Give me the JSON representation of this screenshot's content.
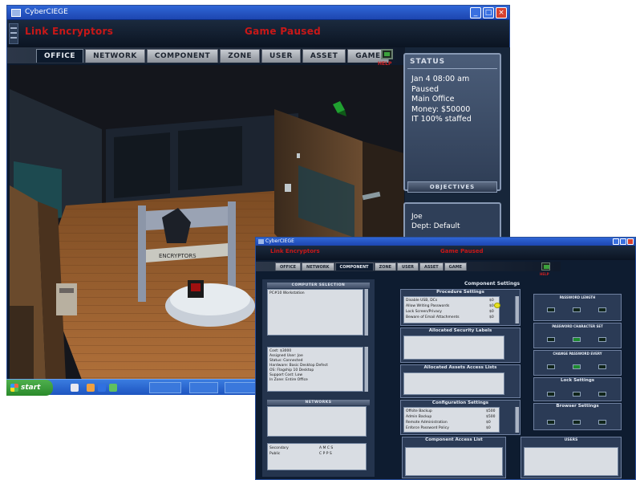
{
  "window1": {
    "title": "CyberCIEGE",
    "header_left": "Link Encryptors",
    "header_center": "Game Paused",
    "tabs": [
      "OFFICE",
      "NETWORK",
      "COMPONENT",
      "ZONE",
      "USER",
      "ASSET",
      "GAME"
    ],
    "active_tab": "OFFICE",
    "help_label": "HELP",
    "status": {
      "heading": "STATUS",
      "lines": [
        "Jan 4 08:00 am",
        "Paused",
        "Main Office",
        "Money: $50000",
        "IT 100% staffed"
      ]
    },
    "objectives_label": "OBJECTIVES",
    "person": {
      "name": "Joe",
      "dept": "Dept: Default"
    },
    "office_sign": "ENCRYPTORS",
    "taskbar": {
      "start_label": "start",
      "items": [
        "",
        "",
        ""
      ]
    }
  },
  "window2": {
    "title": "CyberCIEGE",
    "header_left": "Link Encryptors",
    "header_center": "Game Paused",
    "tabs": [
      "OFFICE",
      "NETWORK",
      "COMPONENT",
      "ZONE",
      "USER",
      "ASSET",
      "GAME"
    ],
    "active_tab": "COMPONENT",
    "help_label": "HELP",
    "computer_selection": {
      "heading": "COMPUTER SELECTION",
      "items": [
        "PC#10 Workstation"
      ],
      "details": [
        "Cost: $3000",
        "Assigned User: Joe",
        "Status: Connected",
        "Hardware: Basic Desktop Defect",
        "OS: Flagship 10 Desktop",
        "Support Cost: Low",
        "In Zone: Entire Office"
      ]
    },
    "network": {
      "heading": "NETWORKS",
      "rows": [
        {
          "label": "Secondary",
          "value": "A M C S"
        },
        {
          "label": "Public",
          "value": "C P P S"
        }
      ]
    },
    "component_settings": {
      "heading": "Component Settings",
      "procedure": {
        "heading": "Procedure Settings",
        "items": [
          {
            "label": "Disable USB, DCs",
            "value": "$0"
          },
          {
            "label": "Allow Writing Passwords",
            "value": "$0"
          },
          {
            "label": "Lock Screen/Privacy",
            "value": "$0"
          },
          {
            "label": "Beware of Email Attachments",
            "value": "$0"
          }
        ]
      },
      "security_labels": {
        "heading": "Allocated Security Labels"
      },
      "asset_access": {
        "heading": "Allocated Assets Access Lists"
      },
      "configuration": {
        "heading": "Configuration Settings",
        "items": [
          {
            "label": "Offsite Backup",
            "value": "$500"
          },
          {
            "label": "Admin Backup",
            "value": "$500"
          },
          {
            "label": "Remote Administration",
            "value": "$0"
          },
          {
            "label": "Enforce Password Policy",
            "value": "$0"
          }
        ]
      }
    },
    "right_groups": [
      {
        "heading": "PASSWORD LENGTH",
        "labels": [
          "",
          "",
          ""
        ]
      },
      {
        "heading": "PASSWORD CHARACTER SET",
        "labels": [
          "",
          "",
          ""
        ]
      },
      {
        "heading": "CHANGE PASSWORD EVERY",
        "labels": [
          "",
          "",
          ""
        ]
      },
      {
        "heading": "Lock Settings",
        "labels": [
          "",
          "",
          ""
        ]
      },
      {
        "heading": "Browser Settings",
        "labels": [
          "",
          "",
          ""
        ]
      }
    ],
    "bottom": {
      "component_access": "Component Access List",
      "users": "USERS"
    }
  }
}
